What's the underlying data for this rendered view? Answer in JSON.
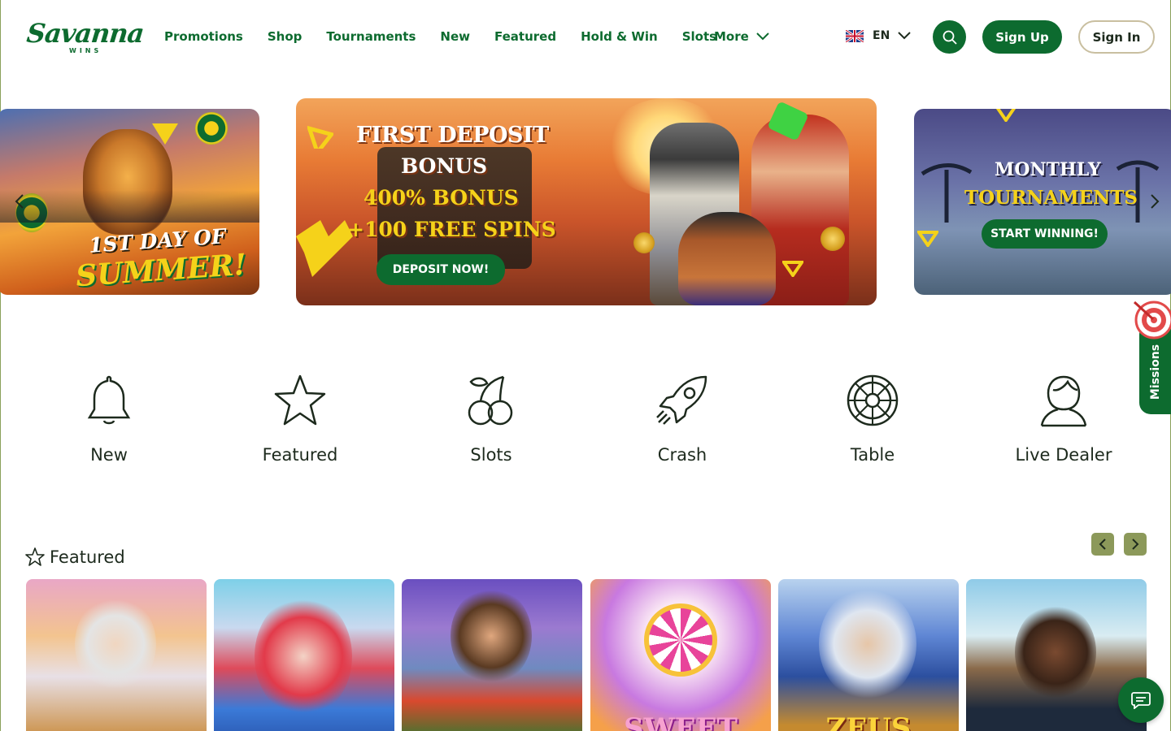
{
  "brand": {
    "name": "Savanna",
    "sub": "WINS"
  },
  "nav": {
    "items": [
      "Promotions",
      "Shop",
      "Tournaments",
      "New",
      "Featured",
      "Hold & Win",
      "Slots"
    ],
    "more_label": "More"
  },
  "language": {
    "code": "EN"
  },
  "auth": {
    "signup_label": "Sign Up",
    "signin_label": "Sign In"
  },
  "banners": {
    "left": {
      "line1": "1ST DAY OF",
      "line2": "SUMMER!"
    },
    "main": {
      "line1": "FIRST DEPOSIT",
      "line2": "BONUS",
      "line3": "400% BONUS",
      "line4": "+100 FREE SPINS",
      "cta": "DEPOSIT NOW!"
    },
    "right": {
      "line1": "MONTHLY",
      "line2": "TOURNAMENTS",
      "cta": "START WINNING!"
    }
  },
  "missions": {
    "label": "Missions"
  },
  "categories": [
    "New",
    "Featured",
    "Slots",
    "Crash",
    "Table",
    "Live Dealer"
  ],
  "featured": {
    "title": "Featured",
    "games": [
      "",
      "",
      "",
      "SWEET",
      "ZEUS",
      ""
    ]
  },
  "colors": {
    "brand_green": "#0d6b2f",
    "accent_yellow": "#f5d21a",
    "arrow_olive": "#8c995a"
  }
}
